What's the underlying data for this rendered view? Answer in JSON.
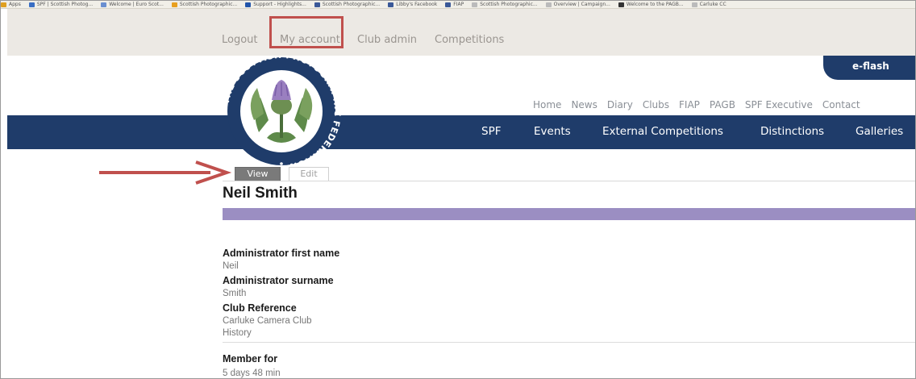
{
  "bookmarks": [
    {
      "label": "Apps",
      "color": "#e0a020"
    },
    {
      "label": "SPF | Scottish Photog...",
      "color": "#3a6fc4"
    },
    {
      "label": "Welcome | Euro Scot...",
      "color": "#6a8fd0"
    },
    {
      "label": "Scottish Photographic...",
      "color": "#e8a020"
    },
    {
      "label": "Support - Highlights...",
      "color": "#2255aa"
    },
    {
      "label": "Scottish Photographic...",
      "color": "#3b5998"
    },
    {
      "label": "Libby's Facebook",
      "color": "#3b5998"
    },
    {
      "label": "FIAP",
      "color": "#3b5998"
    },
    {
      "label": "Scottish Photographic...",
      "color": "#bbbbbb"
    },
    {
      "label": "Overview | Campaign...",
      "color": "#bbbbbb"
    },
    {
      "label": "Welcome to the PAGB...",
      "color": "#333333"
    },
    {
      "label": "Carluke CC",
      "color": "#bbbbbb"
    }
  ],
  "admin_bar": {
    "logout": "Logout",
    "my_account": "My account",
    "club_admin": "Club admin",
    "competitions": "Competitions"
  },
  "eflash": "e-flash",
  "logo": {
    "text": "THE SCOTTISH PHOTOGRAPHIC FEDERATION",
    "navy": "#1f3c6a"
  },
  "top_nav": [
    "Home",
    "News",
    "Diary",
    "Clubs",
    "FIAP",
    "PAGB",
    "SPF Executive",
    "Contact"
  ],
  "main_nav": [
    "SPF",
    "Events",
    "External Competitions",
    "Distinctions",
    "Galleries"
  ],
  "tabs": {
    "view": "View",
    "edit": "Edit"
  },
  "profile": {
    "name": "Neil Smith",
    "fields": [
      {
        "label": "Administrator first name",
        "value": "Neil"
      },
      {
        "label": "Administrator surname",
        "value": "Smith"
      },
      {
        "label": "Club Reference",
        "value": "Carluke Camera Club"
      }
    ],
    "history_heading": "History",
    "member_for_label": "Member for",
    "member_for_value": "5 days 48 min"
  },
  "colors": {
    "navy": "#1f3c6a",
    "purple_bar": "#9b8ec2",
    "highlight": "#c0504d",
    "arrow": "#c0504d"
  }
}
